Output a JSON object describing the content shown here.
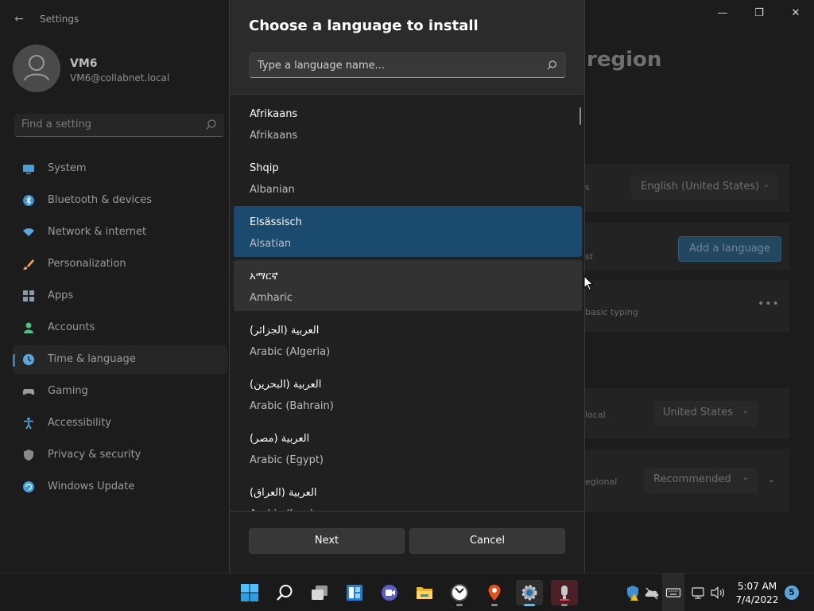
{
  "window": {
    "app_title": "Settings",
    "back_label": "←",
    "minimize": "—",
    "maximize": "❐",
    "close": "✕"
  },
  "profile": {
    "name": "VM6",
    "email": "VM6@collabnet.local"
  },
  "search": {
    "placeholder": "Find a setting"
  },
  "sidebar": {
    "items": [
      {
        "label": "System",
        "icon": "system-icon",
        "color": "#4a9fd8"
      },
      {
        "label": "Bluetooth & devices",
        "icon": "bluetooth-icon",
        "color": "#3f8fd2"
      },
      {
        "label": "Network & internet",
        "icon": "wifi-icon",
        "color": "#5aa7e0"
      },
      {
        "label": "Personalization",
        "icon": "brush-icon",
        "color": "#e8a060"
      },
      {
        "label": "Apps",
        "icon": "apps-icon",
        "color": "#8a9aa8"
      },
      {
        "label": "Accounts",
        "icon": "person-icon",
        "color": "#4ec27a"
      },
      {
        "label": "Time & language",
        "icon": "clock-globe-icon",
        "color": "#5aa7e0"
      },
      {
        "label": "Gaming",
        "icon": "gamepad-icon",
        "color": "#9a9a9a"
      },
      {
        "label": "Accessibility",
        "icon": "accessibility-icon",
        "color": "#4a9fd8"
      },
      {
        "label": "Privacy & security",
        "icon": "shield-icon",
        "color": "#8a8a8a"
      },
      {
        "label": "Windows Update",
        "icon": "update-icon",
        "color": "#3f9fe0"
      }
    ],
    "active_index": 6
  },
  "background_page": {
    "title": "region",
    "display_language_value": "English (United States)",
    "add_language_button": "Add a language",
    "row_text_1": "s",
    "row_text_2": "st",
    "row_text_3": "basic typing",
    "country_label": "local",
    "country_value": "United States",
    "regional_label": "egional",
    "regional_value": "Recommended",
    "more_options": "•••"
  },
  "dialog": {
    "title": "Choose a language to install",
    "search_placeholder": "Type a language name...",
    "languages": [
      {
        "native": "Afrikaans",
        "english": "Afrikaans",
        "state": "normal"
      },
      {
        "native": "Shqip",
        "english": "Albanian",
        "state": "normal"
      },
      {
        "native": "Elsässisch",
        "english": "Alsatian",
        "state": "selected"
      },
      {
        "native": "አማርኛ",
        "english": "Amharic",
        "state": "hover"
      },
      {
        "native": "العربية (الجزائر)",
        "english": "Arabic (Algeria)",
        "state": "normal"
      },
      {
        "native": "العربية (البحرين)",
        "english": "Arabic (Bahrain)",
        "state": "normal"
      },
      {
        "native": "العربية (مصر)",
        "english": "Arabic (Egypt)",
        "state": "normal"
      },
      {
        "native": "العربية (العراق)",
        "english": "Arabic (Iraq)",
        "state": "normal"
      }
    ],
    "next_button": "Next",
    "cancel_button": "Cancel",
    "selected_color": "#1a4a6e"
  },
  "taskbar": {
    "apps": [
      {
        "name": "start-icon"
      },
      {
        "name": "search-icon"
      },
      {
        "name": "task-view-icon"
      },
      {
        "name": "widgets-icon"
      },
      {
        "name": "teams-chat-icon"
      },
      {
        "name": "file-explorer-icon"
      },
      {
        "name": "clock-app-icon"
      },
      {
        "name": "maps-icon"
      },
      {
        "name": "settings-icon"
      },
      {
        "name": "recorder-icon"
      }
    ],
    "clock_time": "5:07 AM",
    "clock_date": "7/4/2022",
    "notification_count": "5",
    "accent_color": "#4cc2ff"
  }
}
